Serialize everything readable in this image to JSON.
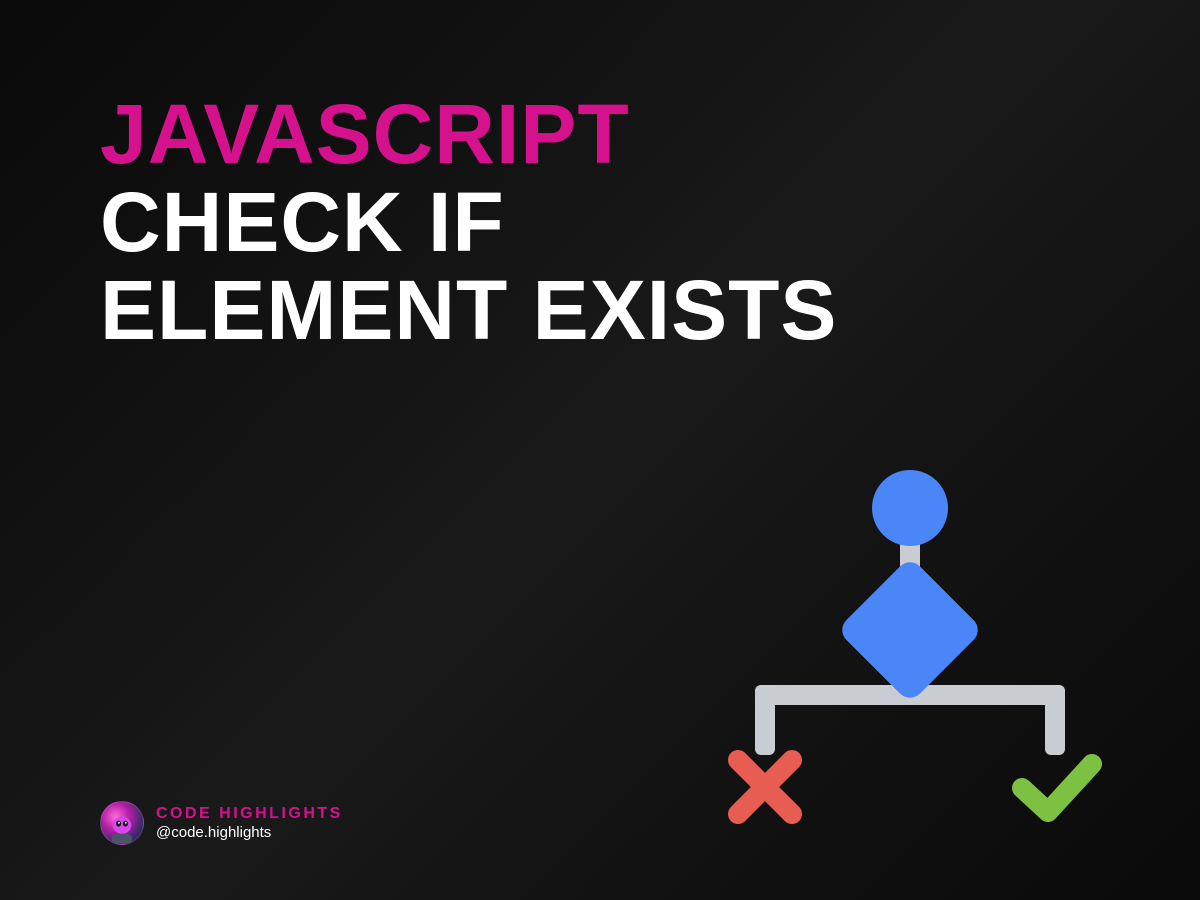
{
  "title": {
    "line1": "JAVASCRIPT",
    "line2": "CHECK IF",
    "line3": "ELEMENT EXISTS"
  },
  "attribution": {
    "brand": "CODE HIGHLIGHTS",
    "handle": "@code.highlights"
  },
  "colors": {
    "accent": "#d6118e",
    "white": "#ffffff",
    "diagram_blue": "#4a86f7",
    "diagram_gray": "#c9cdd1",
    "diagram_red": "#e85d52",
    "diagram_green": "#7cc142"
  }
}
